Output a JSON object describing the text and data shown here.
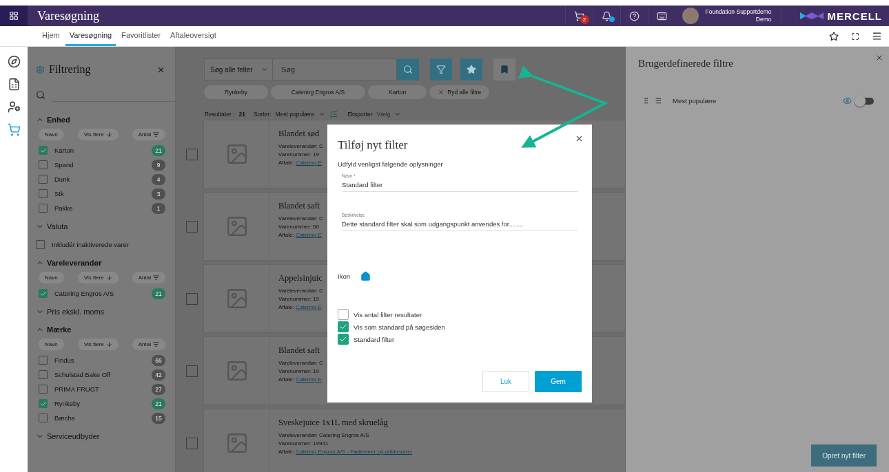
{
  "header": {
    "app_title": "Varesøgning",
    "cart_count": "2",
    "user_name": "Foundation Supportdemo",
    "user_role": "Demo",
    "brand": "MERCELL"
  },
  "nav": {
    "tabs": [
      {
        "label": "Hjem",
        "selected": false
      },
      {
        "label": "Varesøgning",
        "selected": true
      },
      {
        "label": "Favoritlister",
        "selected": false
      },
      {
        "label": "Aftaleoversigt",
        "selected": false
      }
    ]
  },
  "rail": [
    {
      "kind": "compass",
      "selected": false
    },
    {
      "kind": "excel",
      "selected": false
    },
    {
      "kind": "user",
      "selected": false
    },
    {
      "kind": "cart",
      "selected": true
    }
  ],
  "filter_panel": {
    "title": "Filtrering",
    "sections": [
      {
        "kind": "group",
        "title": "Enhed",
        "expanded": true,
        "sort_buttons": [
          "Navn",
          "Vis flere",
          "Antal"
        ],
        "items": [
          {
            "label": "Karton",
            "checked": true,
            "count": "21"
          },
          {
            "label": "Spand",
            "checked": false,
            "count": "9"
          },
          {
            "label": "Dunk",
            "checked": false,
            "count": "4"
          },
          {
            "label": "Stk",
            "checked": false,
            "count": "3"
          },
          {
            "label": "Pakke",
            "checked": false,
            "count": "1"
          }
        ]
      },
      {
        "kind": "group",
        "title": "Valuta",
        "expanded": false
      },
      {
        "kind": "option",
        "label": "Inkludér inaktiverede varer",
        "checked": false
      },
      {
        "kind": "group",
        "title": "Vareleverandør",
        "expanded": true,
        "sort_buttons": [
          "Navn",
          "Vis flere",
          "Antal"
        ],
        "items": [
          {
            "label": "Catering Engros A/S",
            "checked": true,
            "count": "21"
          }
        ]
      },
      {
        "kind": "group",
        "title": "Pris ekskl. moms",
        "expanded": false
      },
      {
        "kind": "group",
        "title": "Mærke",
        "expanded": true,
        "sort_buttons": [
          "Navn",
          "Vis flere",
          "Antal"
        ],
        "items": [
          {
            "label": "Findus",
            "checked": false,
            "count": "66"
          },
          {
            "label": "Schulstad Bake Off",
            "checked": false,
            "count": "42"
          },
          {
            "label": "PRIMA FRUGT",
            "checked": false,
            "count": "27"
          },
          {
            "label": "Rynkeby",
            "checked": true,
            "count": "21"
          },
          {
            "label": "Bæchs",
            "checked": false,
            "count": "15"
          }
        ]
      },
      {
        "kind": "group",
        "title": "Serviceudbyder",
        "expanded": false
      }
    ]
  },
  "search": {
    "scope": "Søg alle felter",
    "placeholder": "Søg",
    "chips": [
      "Rynkeby",
      "Catering Engros A/S",
      "Karton"
    ],
    "clear": "Ryd alle filtre",
    "results_label": "Resultater :",
    "results_count": "21",
    "sort_label": "Sorter:",
    "sort_value": "Mest populære",
    "export_label": "Eksporter",
    "export_placeholder": "Vælg"
  },
  "products": [
    {
      "title": "Blandet sød",
      "supplier": "Vareleverandør: C",
      "number": "Varenummer: 19",
      "agreement_label": "Aftale:",
      "agreement_link": "Catering E",
      "checked": false
    },
    {
      "title": "Blandet saft",
      "supplier": "Vareleverandør: C",
      "number": "Varenummer: 50",
      "agreement_label": "Aftale:",
      "agreement_link": "Catering E",
      "checked": false
    },
    {
      "title": "Appelsinjuic",
      "supplier": "Vareleverandør: C",
      "number": "Varenummer: 19",
      "agreement_label": "Aftale:",
      "agreement_link": "Catering E",
      "checked": false
    },
    {
      "title": "Blandet saft",
      "supplier": "Vareleverandør: C",
      "number": "Varenummer: 19",
      "agreement_label": "Aftale:",
      "agreement_link": "Catering E",
      "checked": false
    },
    {
      "title": "Sveskejuice 1x1L med skruelåg",
      "supplier": "Vareleverandør: Catering Engros A/S",
      "number": "Varenummer: 19941",
      "agreement_label": "Aftale:",
      "agreement_link": "Catering Engros A/S - Fødevarer og drikkevarer",
      "checked": false
    }
  ],
  "custom_filters": {
    "title": "Brugerdefinerede filtre",
    "filters": [
      {
        "label": "Mest populære",
        "visible": true,
        "on": false
      }
    ],
    "create_button": "Opret nyt filter"
  },
  "dialog": {
    "title": "Tilføj nyt filter",
    "intro": "Udfyld venligst følgende oplysninger",
    "fields": [
      {
        "label": "Navn *",
        "value": "Standard filter"
      },
      {
        "label": "Beskrivelse",
        "value": "Dette standard filter skal som udgangspunkt anvendes for........"
      }
    ],
    "icon_label": "Ikon",
    "options": [
      {
        "label": "Vis antal filter resultater",
        "checked": false
      },
      {
        "label": "Vis som standard på søgesiden",
        "checked": true
      },
      {
        "label": "Standard filter",
        "checked": true
      }
    ],
    "cancel": "Luk",
    "save": "Gem"
  }
}
